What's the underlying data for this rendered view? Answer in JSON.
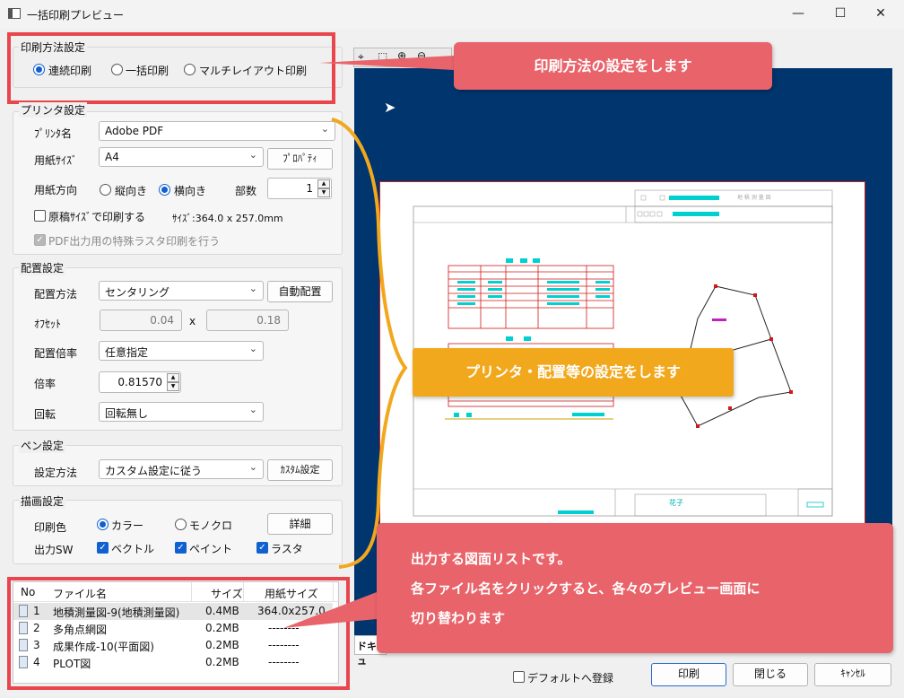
{
  "window": {
    "title": "一括印刷プレビュー",
    "min": "—",
    "max": "☐",
    "close": "✕"
  },
  "print_method": {
    "title": "印刷方法設定",
    "options": [
      "連続印刷",
      "一括印刷",
      "マルチレイアウト印刷"
    ],
    "selected": 0
  },
  "printer": {
    "title": "プリンタ設定",
    "name_label": "ﾌﾟﾘﾝﾀ名",
    "name_value": "Adobe PDF",
    "paper_label": "用紙ｻｲｽﾞ",
    "paper_value": "A4",
    "property_btn": "ﾌﾟﾛﾊﾟﾃｨ",
    "orient_label": "用紙方向",
    "orient_portrait": "縦向き",
    "orient_landscape": "横向き",
    "copies_label": "部数",
    "copies_value": "1",
    "original_size_label": "原稿ｻｲｽﾞで印刷する",
    "size_text": "ｻｲｽﾞ:364.0 x 257.0mm",
    "pdf_raster_label": "PDF出力用の特殊ラスタ印刷を行う"
  },
  "layout": {
    "title": "配置設定",
    "method_label": "配置方法",
    "method_value": "センタリング",
    "auto_btn": "自動配置",
    "offset_label": "ｵﾌｾｯﾄ",
    "offset_x": "0.04",
    "offset_sep": "x",
    "offset_y": "0.18",
    "scale_mode_label": "配置倍率",
    "scale_mode_value": "任意指定",
    "scale_label": "倍率",
    "scale_value": "0.81570",
    "rotate_label": "回転",
    "rotate_value": "回転無し"
  },
  "pen": {
    "title": "ペン設定",
    "method_label": "設定方法",
    "method_value": "カスタム設定に従う",
    "custom_btn": "ｶｽﾀﾑ設定"
  },
  "draw": {
    "title": "描画設定",
    "color_label": "印刷色",
    "color_opt": "カラー",
    "mono_opt": "モノクロ",
    "detail_btn": "詳細",
    "output_label": "出力SW",
    "vector": "ベクトル",
    "paint": "ペイント",
    "raster": "ラスタ"
  },
  "file_table": {
    "headers": [
      "No",
      "ファイル名",
      "サイズ",
      "用紙サイズ"
    ],
    "rows": [
      {
        "no": "1",
        "name": "地積測量図-9(地積測量図)",
        "size": "0.4MB",
        "paper": "364.0x257.0"
      },
      {
        "no": "2",
        "name": "多角点網図",
        "size": "0.2MB",
        "paper": "--------"
      },
      {
        "no": "3",
        "name": "成果作成-10(平面図)",
        "size": "0.2MB",
        "paper": "--------"
      },
      {
        "no": "4",
        "name": "PLOT図",
        "size": "0.2MB",
        "paper": "--------"
      }
    ]
  },
  "bottom": {
    "default_label": "デフォルトへ登録",
    "print_btn": "印刷",
    "close_btn": "閉じる",
    "cancel_btn": "ｷｬﾝｾﾙ"
  },
  "preview": {
    "doc_label": "ドキュ",
    "stamp_text": "花子",
    "title_block": "地 積 測 量 図"
  },
  "callouts": {
    "method": "印刷方法の設定をします",
    "printer": "プリンタ・配置等の設定をします",
    "list_line1": "出力する図面リストです。",
    "list_line2": "各ファイル名をクリックすると、各々のプレビュー画面に",
    "list_line3": "切り替わります"
  },
  "colors": {
    "callout_red": "#e8646a",
    "callout_orange": "#f2a81d",
    "preview_bg": "#00356e",
    "highlight_red": "#e8464c"
  }
}
